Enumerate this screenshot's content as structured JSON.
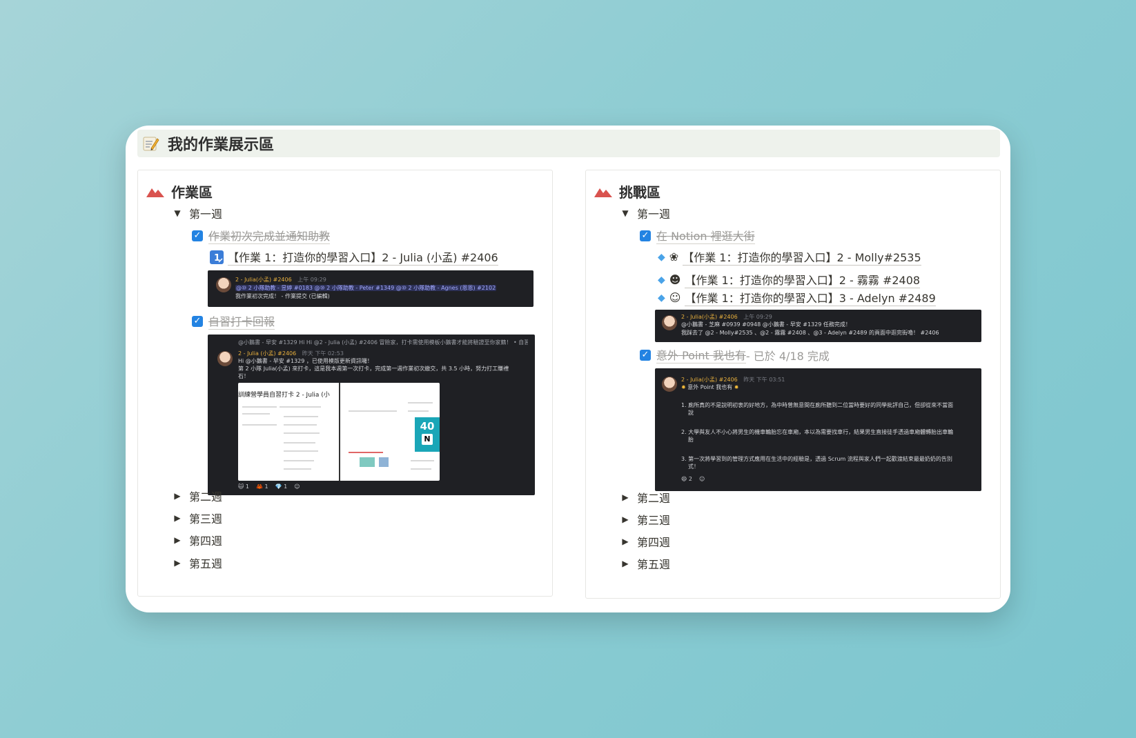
{
  "page_title": "我的作業展示區",
  "left": {
    "title": "作業區",
    "week1_label": "第一週",
    "task1": {
      "label": "作業初次完成並通知助教",
      "link": "【作業 1：打造你的學習入口】2 - Julia (小孟) #2406",
      "shot": {
        "author": "2 - Julia(小孟) #2406",
        "time": "上午 09:29",
        "line1": "@⑩ 2 小隊助教 - 昱婷 #0183  @⑩ 2 小隊助教 - Peter #1349  @⑩ 2 小隊助教 - Agnes (恩恩) #2102",
        "line2": "我作業初次完成！ - 作業提交 (已編輯)"
      }
    },
    "task2": {
      "label": "自習打卡回報",
      "shot": {
        "reply": "@小鵝書 - 早安 #1329  Hi Hi  @2 - Julia (小孟) #2406  冒險家，打卡需使用模板小鵝書才能將驗證至你家籍！ • 自習...",
        "author": "2 - Julia (小孟) #2406",
        "time": "昨天 下午 02:53",
        "line1": "Hi  @小鵝書 - 早安 #1329  ，已使用模版更新資訊囉！",
        "line2": "第 2 小隊 Julia(小孟) 來打卡，這是我本週第一次打卡，完成第一週作業初次繳交，共 3.5 小時，努力打工賺禮",
        "line3": "石！",
        "doc_title": "訓練營學員自習打卡 2 - Julia (小",
        "badge": "40",
        "reactions": [
          "1",
          "1",
          "1"
        ]
      }
    },
    "weeks": [
      "第二週",
      "第三週",
      "第四週",
      "第五週"
    ]
  },
  "right": {
    "title": "挑戰區",
    "week1_label": "第一週",
    "task1": {
      "label": "在 Notion 裡逛大街",
      "links": [
        "【作業 1：打造你的學習入口】2 - Molly#2535",
        "【作業 1：打造你的學習入口】2 - 霧霧 #2408",
        "【作業 1：打造你的學習入口】3 - Adelyn #2489"
      ],
      "shot": {
        "author": "2 - Julia(小孟) #2406",
        "time": "上午 09:29",
        "line1": "@小鵝書 - 芝麻 #0939 #0948  @小鵝書 - 早安 #1329  任務完成！",
        "line2": "我踩去了 @2 - Molly#2535 、@2 - 霧霧 #2408 、@3 - Adelyn #2489 的頁面中逛完街嚕！ #2406"
      }
    },
    "task2": {
      "label": "意外 Point 我也有",
      "suffix": " - 已於 4/18 完成",
      "shot": {
        "author": "2 - Julia(小孟) #2406",
        "time": "昨天 下午 03:51",
        "intro": "意外 Point 我也有",
        "items": [
          "1. 廁所真的不是說明初衷的好地方，為中時曾無意間在廁所聽到二位當時要好的同學批評自己，但卻從來不當面",
          "說",
          "2. 大學與友人不小心將男生的機車輪胎忘在車廂，本以為需要找車行，結果男生直接徒手透過車廂體轉胎出車輪",
          "胎",
          "3. 第一次將學習到的管理方式應用在生活中的經驗是，透過 Scrum 流程與家人們一起歡渡結束最最奶奶的告別",
          "式！"
        ],
        "reactions": [
          "2"
        ]
      }
    },
    "weeks": [
      "第二週",
      "第三週",
      "第四週",
      "第五週"
    ]
  }
}
